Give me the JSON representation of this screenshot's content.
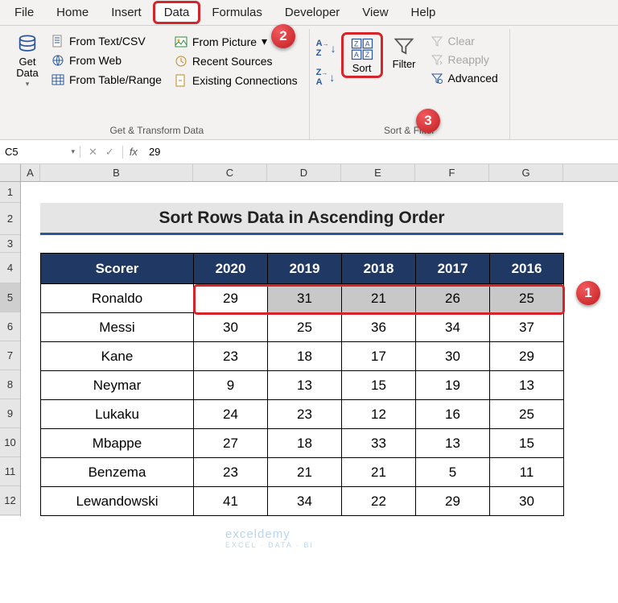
{
  "tabs": [
    "File",
    "Home",
    "Insert",
    "Data",
    "Formulas",
    "Developer",
    "View",
    "Help"
  ],
  "active_tab": "Data",
  "ribbon": {
    "get_data": "Get\nData",
    "from_text": "From Text/CSV",
    "from_web": "From Web",
    "from_table": "From Table/Range",
    "from_pic": "From Picture",
    "recent": "Recent Sources",
    "existing": "Existing Connections",
    "group1_label": "Get & Transform Data",
    "sort_asc": "A→Z",
    "sort_desc": "Z→A",
    "sort": "Sort",
    "filter": "Filter",
    "clear": "Clear",
    "reapply": "Reapply",
    "advanced": "Advanced",
    "group2_label": "Sort & Filter"
  },
  "callouts": {
    "c1": "1",
    "c2": "2",
    "c3": "3"
  },
  "formula": {
    "cell": "C5",
    "value": "29",
    "fx": "fx"
  },
  "columns": [
    "A",
    "B",
    "C",
    "D",
    "E",
    "F",
    "G"
  ],
  "row_nums": [
    "1",
    "2",
    "3",
    "4",
    "5",
    "6",
    "7",
    "8",
    "9",
    "10",
    "11",
    "12"
  ],
  "title": "Sort Rows Data in Ascending Order",
  "headers": {
    "scorer": "Scorer",
    "y0": "2020",
    "y1": "2019",
    "y2": "2018",
    "y3": "2017",
    "y4": "2016"
  },
  "rows": [
    {
      "n": "Ronaldo",
      "v": [
        "29",
        "31",
        "21",
        "26",
        "25"
      ]
    },
    {
      "n": "Messi",
      "v": [
        "30",
        "25",
        "36",
        "34",
        "37"
      ]
    },
    {
      "n": "Kane",
      "v": [
        "23",
        "18",
        "17",
        "30",
        "29"
      ]
    },
    {
      "n": "Neymar",
      "v": [
        "9",
        "13",
        "15",
        "19",
        "13"
      ]
    },
    {
      "n": "Lukaku",
      "v": [
        "24",
        "23",
        "12",
        "16",
        "25"
      ]
    },
    {
      "n": "Mbappe",
      "v": [
        "27",
        "18",
        "33",
        "13",
        "15"
      ]
    },
    {
      "n": "Benzema",
      "v": [
        "23",
        "21",
        "21",
        "5",
        "11"
      ]
    },
    {
      "n": "Lewandowski",
      "v": [
        "41",
        "34",
        "22",
        "29",
        "30"
      ]
    }
  ],
  "watermark": {
    "brand": "exceldemy",
    "tag": "EXCEL · DATA · BI"
  },
  "chart_data": {
    "type": "table",
    "title": "Sort Rows Data in Ascending Order",
    "columns": [
      "Scorer",
      "2020",
      "2019",
      "2018",
      "2017",
      "2016"
    ],
    "rows": [
      [
        "Ronaldo",
        29,
        31,
        21,
        26,
        25
      ],
      [
        "Messi",
        30,
        25,
        36,
        34,
        37
      ],
      [
        "Kane",
        23,
        18,
        17,
        30,
        29
      ],
      [
        "Neymar",
        9,
        13,
        15,
        19,
        13
      ],
      [
        "Lukaku",
        24,
        23,
        12,
        16,
        25
      ],
      [
        "Mbappe",
        27,
        18,
        33,
        13,
        15
      ],
      [
        "Benzema",
        23,
        21,
        21,
        5,
        11
      ],
      [
        "Lewandowski",
        41,
        34,
        22,
        29,
        30
      ]
    ]
  }
}
